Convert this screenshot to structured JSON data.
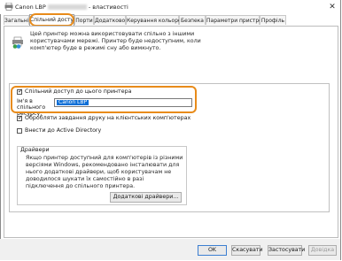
{
  "window": {
    "title_prefix": "Canon LBP",
    "title_suffix": "- властивості",
    "close_glyph": "✕"
  },
  "tabs": [
    {
      "label": "Загальні",
      "active": false
    },
    {
      "label": "Спільний доступ",
      "active": true
    },
    {
      "label": "Порти",
      "active": false
    },
    {
      "label": "Додатково",
      "active": false
    },
    {
      "label": "Керування кольором",
      "active": false
    },
    {
      "label": "Безпека",
      "active": false
    },
    {
      "label": "Параметри пристрою",
      "active": false
    },
    {
      "label": "Профіль",
      "active": false
    }
  ],
  "sharing": {
    "info_icon": "shared-printer-icon",
    "info_text": "Цей принтер можна використовувати спільно з іншими користувачами мережі. Принтер буде недоступним, коли комп'ютер буде в режимі сну або вимкнуто.",
    "share_checkbox_label": "Спільний доступ до цього принтера",
    "share_checked": true,
    "share_name_label": "Ім'я в спільного ресурсу:",
    "share_name_value": "Canon LBP",
    "render_jobs_label": "Обробляти завдання друку на клієнтських комп'ютерах",
    "render_jobs_checked": true,
    "active_directory_label": "Внести до Active Directory",
    "active_directory_checked": false
  },
  "drivers": {
    "title": "Драйвери",
    "text": "Якщо принтер доступний для комп'ютерів із різними версіями Windows, рекомендовано інсталювати для нього додаткові драйвери, щоб користувачам не доводилося шукати їх самостійно в разі підключення до спільного принтера.",
    "add_button": "Додаткові драйвери..."
  },
  "buttons": {
    "ok": "OK",
    "cancel": "Скасувати",
    "apply": "Застосувати",
    "help": "Довідка"
  },
  "colors": {
    "highlight": "#e88b1a",
    "selection": "#0f6fd6"
  }
}
